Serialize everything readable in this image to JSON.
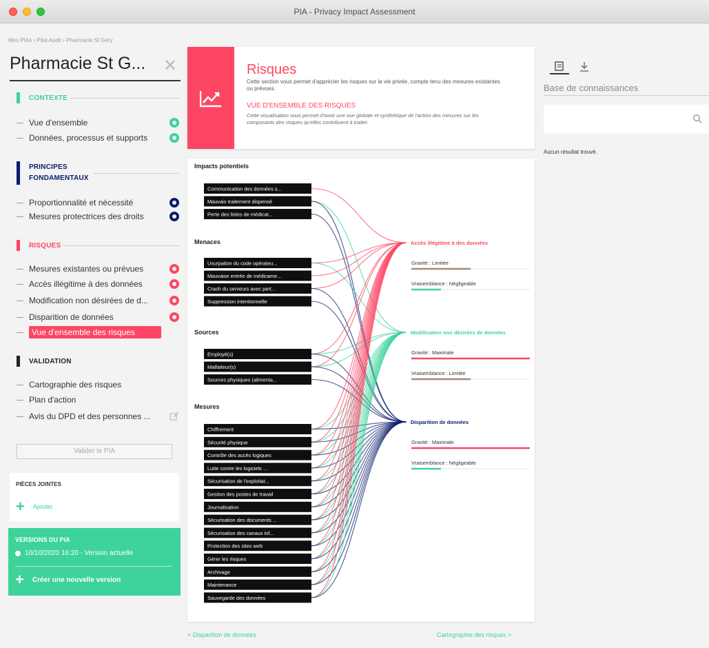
{
  "window": {
    "title": "PIA - Privacy Impact Assessment"
  },
  "breadcrumb": "Mes PIAs › Pilot Audit › Pharmacie St Gery",
  "pia_title": "Pharmacie St G...",
  "sidebar": {
    "sections": [
      {
        "title": "CONTEXTE",
        "color": "#3dd39b",
        "items": [
          {
            "label": "Vue d'ensemble",
            "icon": "gear-icon",
            "status_color": "#3dd39b"
          },
          {
            "label": "Données, processus et supports",
            "icon": "gear-icon",
            "status_color": "#3dd39b"
          }
        ]
      },
      {
        "title": "PRINCIPES FONDAMENTAUX",
        "color": "#091c6b",
        "items": [
          {
            "label": "Proportionnalité et nécessité",
            "icon": "gear-icon",
            "status_color": "#091c6b"
          },
          {
            "label": "Mesures protectrices des droits",
            "icon": "gear-icon",
            "status_color": "#091c6b"
          }
        ]
      },
      {
        "title": "RISQUES",
        "color": "#fd4664",
        "items": [
          {
            "label": "Mesures existantes ou prévues",
            "icon": "gear-icon",
            "status_color": "#fd4664"
          },
          {
            "label": "Accès illégitime à des données",
            "icon": "gear-icon",
            "status_color": "#fd4664"
          },
          {
            "label": "Modification non désirées de d...",
            "icon": "gear-icon",
            "status_color": "#fd4664"
          },
          {
            "label": "Disparition de données",
            "icon": "gear-icon",
            "status_color": "#fd4664"
          },
          {
            "label": "Vue d'ensemble des risques",
            "active": true
          }
        ]
      },
      {
        "title": "VALIDATION",
        "color": "#222222",
        "items": [
          {
            "label": "Cartographie des risques"
          },
          {
            "label": "Plan d'action"
          },
          {
            "label": "Avis du DPD et des personnes ...",
            "icon": "edit-icon"
          }
        ]
      }
    ],
    "validate_button": "Valider le PIA"
  },
  "attachments": {
    "title": "PIÈCES JOINTES",
    "add_label": "Ajouter"
  },
  "versions": {
    "title": "VERSIONS DU PIA",
    "current": "10/10/2020 16:20 - Version actuelle",
    "new_label": "Créer une nouvelle version"
  },
  "intro": {
    "title": "Risques",
    "text": "Cette section vous permet d'apprécier les risques sur la vie privée, compte tenu des mesures existantes ou prévues.",
    "subtitle": "VUE D'ENSEMBLE DES RISQUES",
    "subtext": "Cette visualisation vous permet d'avoir une vue globale et synthétique de l'action des mesures sur les composants des risques qu'elles contribuent à traiter.",
    "accent": "#fd4664"
  },
  "overview": {
    "groups": [
      {
        "title": "Impacts potentiels",
        "items": [
          "Communication des données s...",
          "Mauvais traitement dispensé",
          "Perte des listes de médicat..."
        ]
      },
      {
        "title": "Menaces",
        "items": [
          "Usurpation du code opérateu...",
          "Mauvaise entrée de médicame...",
          "Crash du serveurs avec pert...",
          "Suppression intentionnelle"
        ]
      },
      {
        "title": "Sources",
        "items": [
          "Employé(s)",
          "Malfaiteur(s)",
          "Sources physiques (alimenta..."
        ]
      },
      {
        "title": "Mesures",
        "items": [
          "Chiffrement",
          "Sécurité physique",
          "Contrôle des accès logiques",
          "Lutte contre les logiciels ...",
          "Sécurisation de l'exploitat...",
          "Gestion des postes de travail",
          "Journalisation",
          "Sécurisation des documents ...",
          "Sécurisation des canaux inf...",
          "Protection des sites web",
          "Gérer les risques",
          "Archivage",
          "Maintenance",
          "Sauvegarde des données"
        ]
      }
    ],
    "risks": [
      {
        "title": "Accès illégitime à des données",
        "color": "#fd4664",
        "gravity": "Gravité : Limitée",
        "gravity_level": 0.5,
        "gravity_color": "#a68a7a",
        "likelihood": "Vraisemblance : Négligeable",
        "likelihood_level": 0.25,
        "likelihood_color": "#3dd39b"
      },
      {
        "title": "Modification non désirées de données",
        "color": "#3dd39b",
        "gravity": "Gravité : Maximale",
        "gravity_level": 1.0,
        "gravity_color": "#fd4664",
        "likelihood": "Vraisemblance : Limitée",
        "likelihood_level": 0.5,
        "likelihood_color": "#a68a7a"
      },
      {
        "title": "Disparition de données",
        "color": "#091c6b",
        "gravity": "Gravité : Maximale",
        "gravity_level": 1.0,
        "gravity_color": "#fd4664",
        "likelihood": "Vraisemblance : Négligeable",
        "likelihood_level": 0.25,
        "likelihood_color": "#3dd39b"
      }
    ]
  },
  "footer": {
    "prev": "< Disparition de données",
    "next": "Cartographie des risques >"
  },
  "right_panel": {
    "tabs": [
      {
        "icon": "book-icon"
      },
      {
        "icon": "download-icon"
      }
    ],
    "title": "Base de connaissances",
    "search_placeholder": "",
    "empty": "Aucun résultat trouvé."
  }
}
